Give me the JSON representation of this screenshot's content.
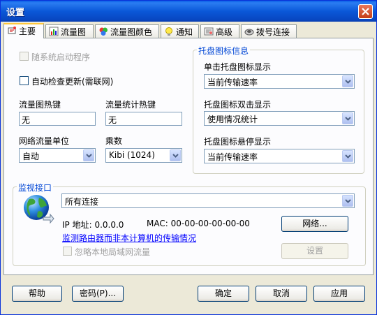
{
  "window": {
    "title": "设置"
  },
  "tabs": [
    {
      "label": "主要",
      "icon": "main-icon"
    },
    {
      "label": "流量图",
      "icon": "chart-icon"
    },
    {
      "label": "流量图颜色",
      "icon": "palette-icon"
    },
    {
      "label": "通知",
      "icon": "bulb-icon"
    },
    {
      "label": "高级",
      "icon": "advanced-icon"
    },
    {
      "label": "拨号连接",
      "icon": "dialup-icon"
    }
  ],
  "general": {
    "startup_label": "随系统启动程序",
    "check_update_label": "自动检查更新(需联网)",
    "graph_hotkey_label": "流量图热键",
    "graph_hotkey_value": "无",
    "stats_hotkey_label": "流量统计热键",
    "stats_hotkey_value": "无",
    "unit_label": "网络流量单位",
    "unit_value": "自动",
    "multiplier_label": "乘数",
    "multiplier_value": "Kibi (1024)"
  },
  "tray": {
    "group_title": "托盘图标信息",
    "click_label": "单击托盘图标显示",
    "click_value": "当前传输速率",
    "dblclick_label": "托盘图标双击显示",
    "dblclick_value": "使用情况统计",
    "hover_label": "托盘图标悬停显示",
    "hover_value": "当前传输速率"
  },
  "monitor": {
    "group_title": "监视接口",
    "interface_value": "所有连接",
    "ip_text": "IP 地址: 0.0.0.0",
    "mac_text": "MAC: 00-00-00-00-00-00",
    "network_button": "网络...",
    "router_link": "监测路由器而非本计算机的传输情况",
    "ignore_lan_label": "忽略本地局域网流量",
    "settings_button": "设置"
  },
  "footer": {
    "help": "帮助",
    "password": "密码(P)...",
    "ok": "确定",
    "cancel": "取消",
    "apply": "应用"
  }
}
